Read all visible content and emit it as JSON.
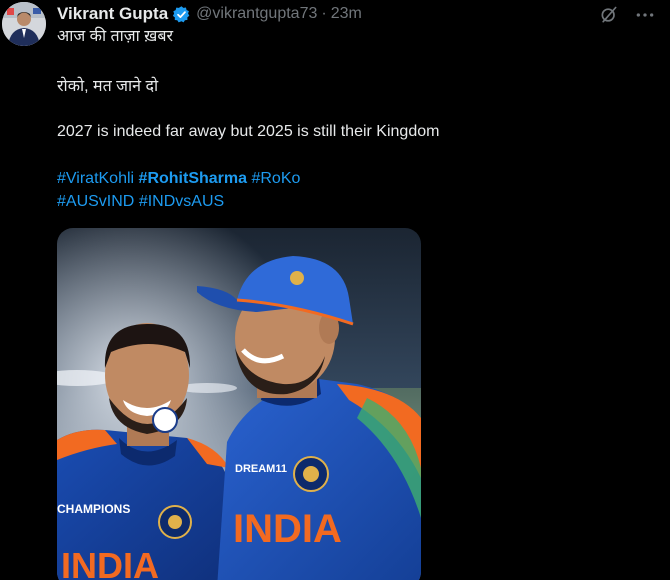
{
  "tweet": {
    "author": {
      "display_name": "Vikrant Gupta",
      "handle": "@vikrantgupta73",
      "verified": true
    },
    "separator": "·",
    "timestamp": "23m",
    "lines": [
      "आज की ताज़ा ख़बर",
      "रोको, मत जाने दो",
      "2027 is indeed far away but 2025 is still their Kingdom"
    ],
    "hashtags_row1": [
      "#ViratKohli",
      "#RohitSharma",
      "#RoKo"
    ],
    "hashtags_row2": [
      "#AUSvIND",
      "#INDvsAUS"
    ],
    "media": {
      "jersey_text_left": "INDIA",
      "jersey_text_right": "INDIA",
      "badge_text": "CHAMPIONS",
      "sponsor_text": "DREAM11"
    },
    "icons": [
      "grok-icon",
      "more-icon"
    ]
  },
  "colors": {
    "background": "#000000",
    "text": "#e7e9ea",
    "muted": "#71767b",
    "link": "#1d9bf0",
    "verified": "#1d9bf0"
  }
}
